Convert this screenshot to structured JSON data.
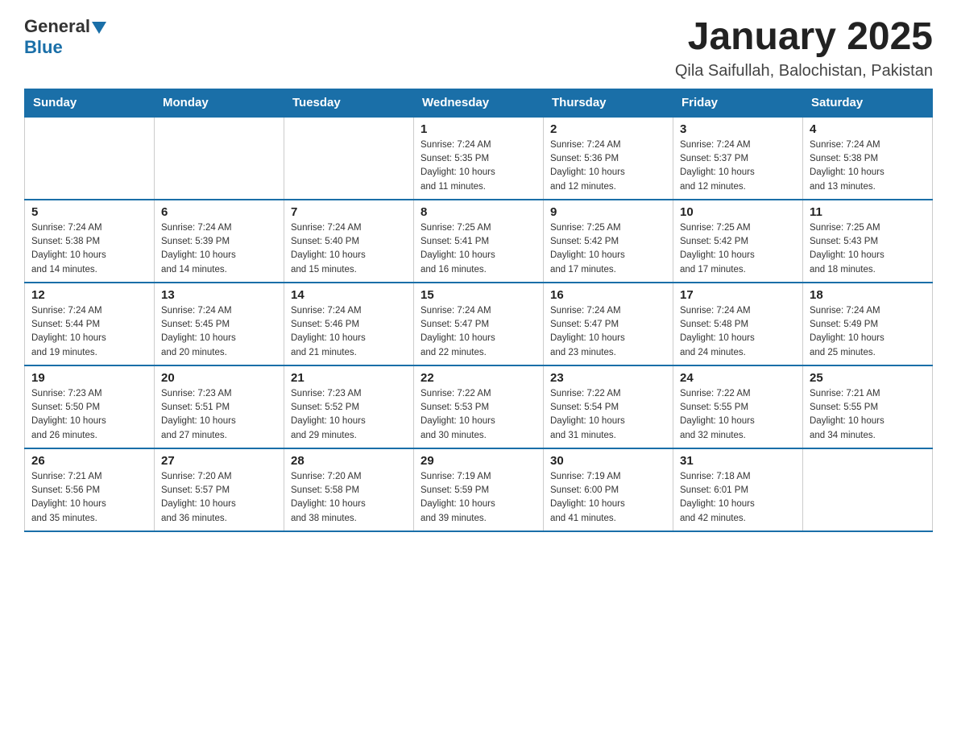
{
  "header": {
    "logo_general": "General",
    "logo_blue": "Blue",
    "title": "January 2025",
    "subtitle": "Qila Saifullah, Balochistan, Pakistan"
  },
  "calendar": {
    "days_of_week": [
      "Sunday",
      "Monday",
      "Tuesday",
      "Wednesday",
      "Thursday",
      "Friday",
      "Saturday"
    ],
    "weeks": [
      [
        {
          "day": "",
          "info": ""
        },
        {
          "day": "",
          "info": ""
        },
        {
          "day": "",
          "info": ""
        },
        {
          "day": "1",
          "info": "Sunrise: 7:24 AM\nSunset: 5:35 PM\nDaylight: 10 hours\nand 11 minutes."
        },
        {
          "day": "2",
          "info": "Sunrise: 7:24 AM\nSunset: 5:36 PM\nDaylight: 10 hours\nand 12 minutes."
        },
        {
          "day": "3",
          "info": "Sunrise: 7:24 AM\nSunset: 5:37 PM\nDaylight: 10 hours\nand 12 minutes."
        },
        {
          "day": "4",
          "info": "Sunrise: 7:24 AM\nSunset: 5:38 PM\nDaylight: 10 hours\nand 13 minutes."
        }
      ],
      [
        {
          "day": "5",
          "info": "Sunrise: 7:24 AM\nSunset: 5:38 PM\nDaylight: 10 hours\nand 14 minutes."
        },
        {
          "day": "6",
          "info": "Sunrise: 7:24 AM\nSunset: 5:39 PM\nDaylight: 10 hours\nand 14 minutes."
        },
        {
          "day": "7",
          "info": "Sunrise: 7:24 AM\nSunset: 5:40 PM\nDaylight: 10 hours\nand 15 minutes."
        },
        {
          "day": "8",
          "info": "Sunrise: 7:25 AM\nSunset: 5:41 PM\nDaylight: 10 hours\nand 16 minutes."
        },
        {
          "day": "9",
          "info": "Sunrise: 7:25 AM\nSunset: 5:42 PM\nDaylight: 10 hours\nand 17 minutes."
        },
        {
          "day": "10",
          "info": "Sunrise: 7:25 AM\nSunset: 5:42 PM\nDaylight: 10 hours\nand 17 minutes."
        },
        {
          "day": "11",
          "info": "Sunrise: 7:25 AM\nSunset: 5:43 PM\nDaylight: 10 hours\nand 18 minutes."
        }
      ],
      [
        {
          "day": "12",
          "info": "Sunrise: 7:24 AM\nSunset: 5:44 PM\nDaylight: 10 hours\nand 19 minutes."
        },
        {
          "day": "13",
          "info": "Sunrise: 7:24 AM\nSunset: 5:45 PM\nDaylight: 10 hours\nand 20 minutes."
        },
        {
          "day": "14",
          "info": "Sunrise: 7:24 AM\nSunset: 5:46 PM\nDaylight: 10 hours\nand 21 minutes."
        },
        {
          "day": "15",
          "info": "Sunrise: 7:24 AM\nSunset: 5:47 PM\nDaylight: 10 hours\nand 22 minutes."
        },
        {
          "day": "16",
          "info": "Sunrise: 7:24 AM\nSunset: 5:47 PM\nDaylight: 10 hours\nand 23 minutes."
        },
        {
          "day": "17",
          "info": "Sunrise: 7:24 AM\nSunset: 5:48 PM\nDaylight: 10 hours\nand 24 minutes."
        },
        {
          "day": "18",
          "info": "Sunrise: 7:24 AM\nSunset: 5:49 PM\nDaylight: 10 hours\nand 25 minutes."
        }
      ],
      [
        {
          "day": "19",
          "info": "Sunrise: 7:23 AM\nSunset: 5:50 PM\nDaylight: 10 hours\nand 26 minutes."
        },
        {
          "day": "20",
          "info": "Sunrise: 7:23 AM\nSunset: 5:51 PM\nDaylight: 10 hours\nand 27 minutes."
        },
        {
          "day": "21",
          "info": "Sunrise: 7:23 AM\nSunset: 5:52 PM\nDaylight: 10 hours\nand 29 minutes."
        },
        {
          "day": "22",
          "info": "Sunrise: 7:22 AM\nSunset: 5:53 PM\nDaylight: 10 hours\nand 30 minutes."
        },
        {
          "day": "23",
          "info": "Sunrise: 7:22 AM\nSunset: 5:54 PM\nDaylight: 10 hours\nand 31 minutes."
        },
        {
          "day": "24",
          "info": "Sunrise: 7:22 AM\nSunset: 5:55 PM\nDaylight: 10 hours\nand 32 minutes."
        },
        {
          "day": "25",
          "info": "Sunrise: 7:21 AM\nSunset: 5:55 PM\nDaylight: 10 hours\nand 34 minutes."
        }
      ],
      [
        {
          "day": "26",
          "info": "Sunrise: 7:21 AM\nSunset: 5:56 PM\nDaylight: 10 hours\nand 35 minutes."
        },
        {
          "day": "27",
          "info": "Sunrise: 7:20 AM\nSunset: 5:57 PM\nDaylight: 10 hours\nand 36 minutes."
        },
        {
          "day": "28",
          "info": "Sunrise: 7:20 AM\nSunset: 5:58 PM\nDaylight: 10 hours\nand 38 minutes."
        },
        {
          "day": "29",
          "info": "Sunrise: 7:19 AM\nSunset: 5:59 PM\nDaylight: 10 hours\nand 39 minutes."
        },
        {
          "day": "30",
          "info": "Sunrise: 7:19 AM\nSunset: 6:00 PM\nDaylight: 10 hours\nand 41 minutes."
        },
        {
          "day": "31",
          "info": "Sunrise: 7:18 AM\nSunset: 6:01 PM\nDaylight: 10 hours\nand 42 minutes."
        },
        {
          "day": "",
          "info": ""
        }
      ]
    ]
  }
}
